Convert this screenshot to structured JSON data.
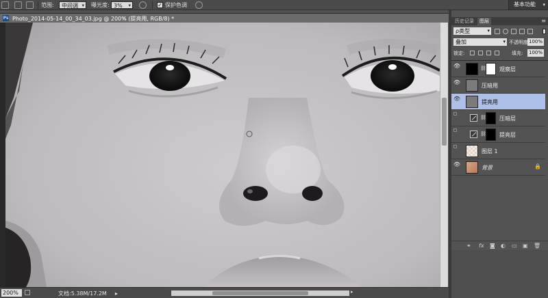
{
  "options_bar": {
    "range_label": "范围:",
    "range_value": "中间调",
    "exposure_label": "曝光度:",
    "exposure_value": "3%",
    "protect_tones_label": "保护色调",
    "protect_tones_checked": "✓",
    "workspace": "基本功能"
  },
  "document": {
    "title": "Photo_2014-05-14_00_34_03.jpg @ 200% (提亮用, RGB/8) *",
    "close": "×"
  },
  "status_bar": {
    "zoom": "200%",
    "doc_size": "文档:5.38M/17.2M",
    "arrow": "▸"
  },
  "panel": {
    "tabs": [
      "历史记录",
      "图层"
    ],
    "active_tab": 1,
    "menu_icon": "≡",
    "filter_kind": "ρ类型",
    "blend_mode": "叠加",
    "opacity_label": "不透明度:",
    "opacity_value": "100%",
    "lock_label": "锁定:",
    "fill_label": "填充:",
    "fill_value": "100%"
  },
  "layers": [
    {
      "name": "观察层",
      "visible": true,
      "type": "group-mask",
      "selected": false
    },
    {
      "name": "压暗用",
      "visible": true,
      "type": "gray",
      "selected": false
    },
    {
      "name": "提亮用",
      "visible": true,
      "type": "gray",
      "selected": true
    },
    {
      "name": "压暗层",
      "visible": false,
      "type": "adjustment",
      "selected": false
    },
    {
      "name": "提亮层",
      "visible": false,
      "type": "adjustment",
      "selected": false
    },
    {
      "name": "图层 1",
      "visible": false,
      "type": "transparent",
      "selected": false
    },
    {
      "name": "背景",
      "visible": true,
      "type": "photo",
      "selected": false,
      "locked": true
    }
  ],
  "layer_footer_icons": [
    "link-icon",
    "fx-icon",
    "mask-icon",
    "adjustment-icon",
    "folder-icon",
    "new-layer-icon",
    "trash-icon"
  ],
  "footer_glyphs": [
    "⚭",
    "fx",
    "◙",
    "◐",
    "▭",
    "▣",
    "🗑"
  ],
  "colors": {
    "ui_dark": "#535353",
    "selected_layer": "#aec0e8",
    "canvas_gray": "#c3c0c3"
  }
}
